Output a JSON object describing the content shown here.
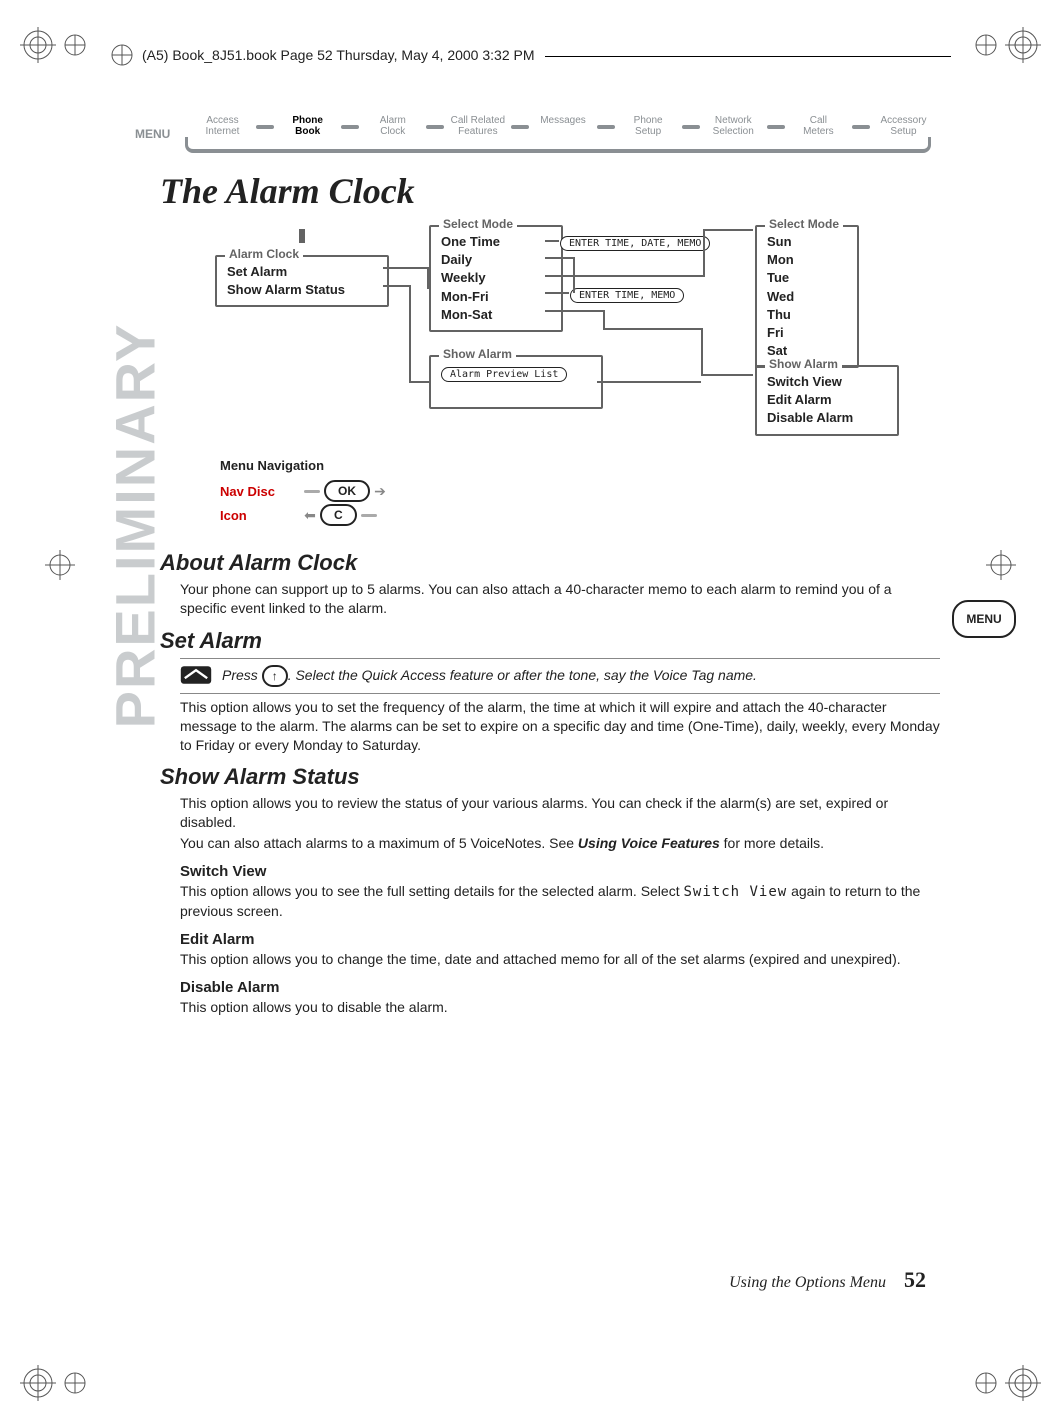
{
  "file_header": "(A5) Book_8J51.book  Page 52  Thursday, May 4, 2000  3:32 PM",
  "menubar": {
    "menu_label": "MENU",
    "items": [
      {
        "l1": "Access",
        "l2": "Internet"
      },
      {
        "l1": "Phone",
        "l2": "Book",
        "active": true
      },
      {
        "l1": "Alarm",
        "l2": "Clock"
      },
      {
        "l1": "Call Related",
        "l2": "Features"
      },
      {
        "l1": "Messages",
        "l2": ""
      },
      {
        "l1": "Phone",
        "l2": "Setup"
      },
      {
        "l1": "Network",
        "l2": "Selection"
      },
      {
        "l1": "Call",
        "l2": "Meters"
      },
      {
        "l1": "Accessory",
        "l2": "Setup"
      }
    ]
  },
  "title": "The Alarm Clock",
  "diagram": {
    "alarm_clock": {
      "legend": "Alarm Clock",
      "rows": [
        "Set Alarm",
        "Show Alarm Status"
      ]
    },
    "select_mode_a": {
      "legend": "Select Mode",
      "rows": [
        "One Time",
        "Daily",
        "Weekly",
        "Mon-Fri",
        "Mon-Sat"
      ]
    },
    "pill_a": "ENTER TIME, DATE, MEMO",
    "pill_b": "ENTER TIME, MEMO",
    "show_alarm_a": {
      "legend": "Show Alarm",
      "pill": "Alarm Preview List"
    },
    "select_mode_b": {
      "legend": "Select Mode",
      "rows": [
        "Sun",
        "Mon",
        "Tue",
        "Wed",
        "Thu",
        "Fri",
        "Sat"
      ]
    },
    "show_alarm_b": {
      "legend": "Show Alarm",
      "rows": [
        "Switch View",
        "Edit Alarm",
        "Disable Alarm"
      ]
    }
  },
  "nav": {
    "hdr": "Menu Navigation",
    "lbl1": "Nav Disc",
    "lbl2": "Icon",
    "ok": "OK",
    "c": "C"
  },
  "prelim": "PRELIMINARY",
  "sections": {
    "about": {
      "h": "About Alarm Clock",
      "p": "Your phone can support up to 5 alarms. You can also attach a 40-character memo to each alarm to remind you of a specific event linked to the alarm."
    },
    "set": {
      "h": "Set Alarm",
      "voice_pre": "Press ",
      "voice_post": ". Select the Quick Access feature or after the tone, say the Voice Tag name.",
      "p": "This option allows you to set the frequency of the alarm, the time at which it will expire and attach the 40-character message to the alarm. The alarms can be set to expire on a specific day and time (One-Time), daily, weekly, every Monday to Friday or every Monday to Saturday."
    },
    "status": {
      "h": "Show Alarm Status",
      "p1": "This option allows you to review the status of your various alarms. You can check if the alarm(s) are set, expired or disabled.",
      "p2a": "You can also attach alarms to a maximum of 5 VoiceNotes. See ",
      "p2b": "Using Voice Features",
      "p2c": " for more details."
    },
    "switch": {
      "h": "Switch View",
      "p_a": "This option allows you to see the full setting details for the selected alarm. Select ",
      "code": "Switch View",
      "p_b": " again to return to the previous screen."
    },
    "edit": {
      "h": "Edit Alarm",
      "p": "This option allows you to change the time, date and attached memo for all of the set alarms (expired and unexpired)."
    },
    "disable": {
      "h": "Disable Alarm",
      "p": "This option allows you to disable the alarm."
    }
  },
  "menu_badge": "MENU",
  "footer": {
    "text": "Using the Options Menu",
    "page": "52"
  }
}
